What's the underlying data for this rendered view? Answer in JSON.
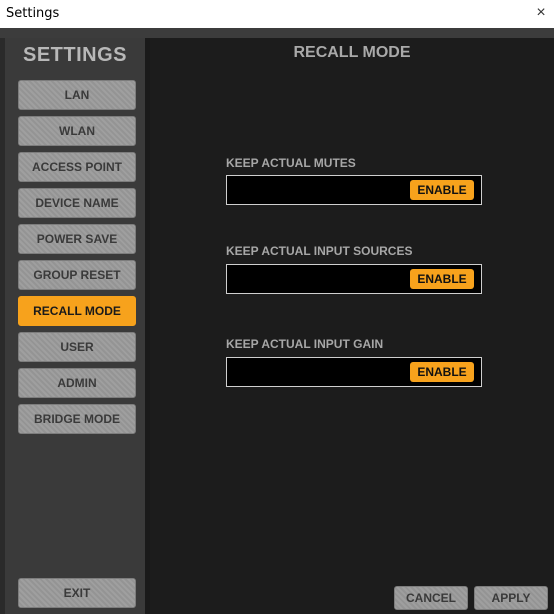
{
  "window": {
    "title": "Settings",
    "close_glyph": "×"
  },
  "sidebar": {
    "title": "SETTINGS",
    "items": [
      {
        "label": "LAN"
      },
      {
        "label": "WLAN"
      },
      {
        "label": "ACCESS POINT"
      },
      {
        "label": "DEVICE NAME"
      },
      {
        "label": "POWER SAVE"
      },
      {
        "label": "GROUP RESET"
      },
      {
        "label": "RECALL MODE",
        "active": true
      },
      {
        "label": "USER"
      },
      {
        "label": "ADMIN"
      },
      {
        "label": "BRIDGE MODE"
      }
    ],
    "exit_label": "EXIT"
  },
  "main": {
    "title": "RECALL MODE",
    "options": [
      {
        "label": "KEEP ACTUAL MUTES",
        "button": "ENABLE"
      },
      {
        "label": "KEEP ACTUAL INPUT SOURCES",
        "button": "ENABLE"
      },
      {
        "label": "KEEP ACTUAL INPUT GAIN",
        "button": "ENABLE"
      }
    ],
    "cancel_label": "CANCEL",
    "apply_label": "APPLY"
  },
  "colors": {
    "accent": "#f7a21c",
    "button_grey": "#9a9a9a",
    "panel_dark": "#1c1c1c",
    "sidebar_bg": "#3a3a3a"
  }
}
